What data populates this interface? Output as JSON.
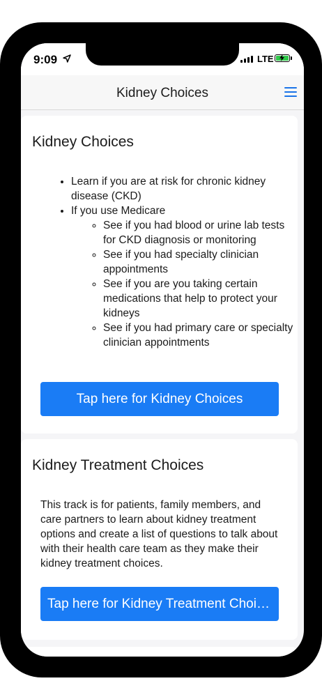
{
  "status_bar": {
    "time": "9:09",
    "network": "LTE"
  },
  "navbar": {
    "title": "Kidney Choices",
    "menu_icon": "hamburger-menu-icon"
  },
  "cards": [
    {
      "title": "Kidney Choices",
      "items": [
        "Learn if you are at risk for chronic kidney disease (CKD)",
        "If you use Medicare"
      ],
      "sub_items": [
        "See if you had blood or urine lab tests for CKD diagnosis or monitoring",
        "See if you had specialty clinician appointments",
        "See if you are you taking certain medications that help to protect your kidneys",
        "See if you had primary care or specialty clinician appointments"
      ],
      "button_label": "Tap here for Kidney Choices"
    },
    {
      "title": "Kidney Treatment Choices",
      "text": "This track is for patients, family members, and care partners to learn about kidney treatment options and create a list of questions to talk about with their health care team as they make their kidney treatment choices.",
      "button_label": "Tap here for Kidney Treatment Choices"
    }
  ],
  "colors": {
    "accent": "#1a7cf5",
    "menu_icon": "#1a73e8",
    "battery": "#30c84a"
  }
}
